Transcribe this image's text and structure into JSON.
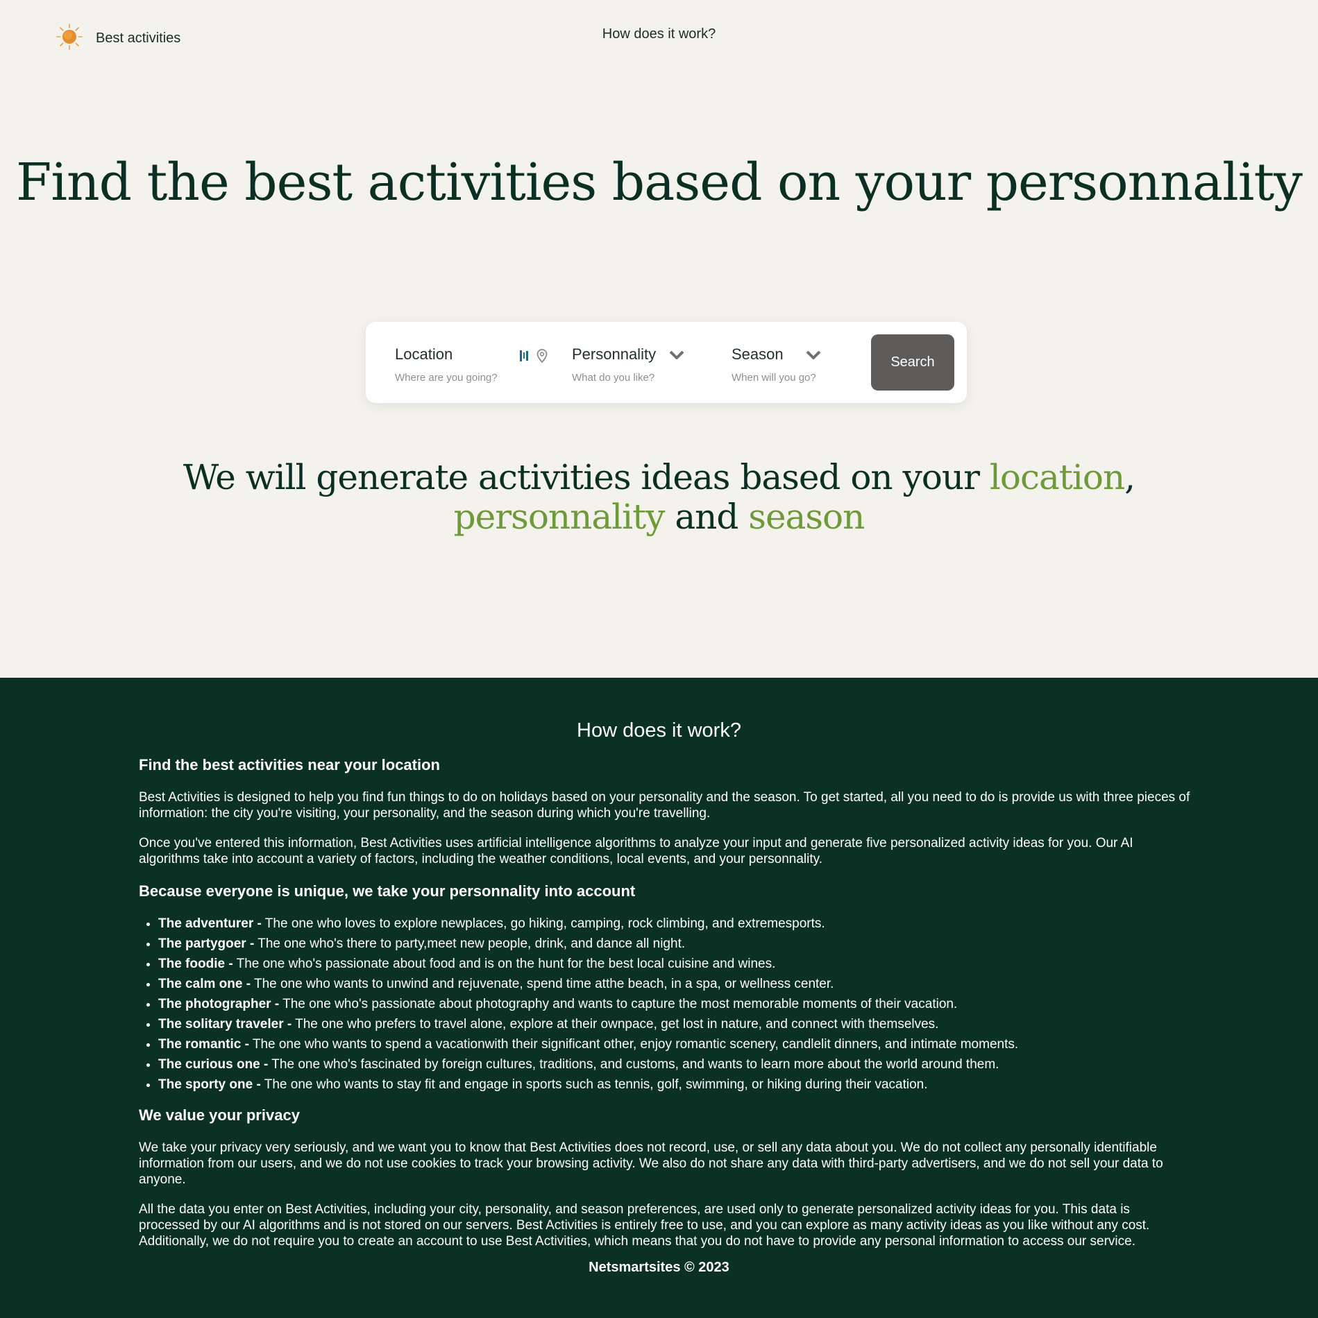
{
  "header": {
    "brand": "Best activities",
    "nav_link": "How does it work?"
  },
  "hero": {
    "title": "Find the best activities based on your personnality"
  },
  "search": {
    "location_label": "Location",
    "location_hint": "Where are you going?",
    "personality_label": "Personnality",
    "personality_hint": "What do you like?",
    "season_label": "Season",
    "season_hint": "When will you go?",
    "button_label": "Search"
  },
  "subtitle": {
    "part1": "We will generate activities ideas based on your ",
    "location": "location",
    "comma": ",",
    "personality": "personnality",
    "and": " and ",
    "season": "season"
  },
  "how": {
    "title": "How does it work?",
    "section1_heading": "Find the best activities near your location",
    "p1": "Best Activities is designed to help you find fun things to do on holidays based on your personality and the season. To get started, all you need to do is provide us with three pieces of information: the city you're visiting, your personality, and the season during which you're travelling.",
    "p2": "Once you've entered this information, Best Activities uses artificial intelligence algorithms to analyze your input and generate five personalized activity ideas for you. Our AI algorithms take into account a variety of factors, including the weather conditions, local events, and your personnality.",
    "section2_heading": "Because everyone is unique, we take your personnality into account",
    "personalities": [
      {
        "name": "The adventurer -",
        "desc": " The one who loves to explore newplaces, go hiking, camping, rock climbing, and extremesports."
      },
      {
        "name": "The partygoer -",
        "desc": " The one who's there to party,meet new people, drink, and dance all night."
      },
      {
        "name": "The foodie -",
        "desc": " The one who's passionate about food and is on the hunt for the best local cuisine and wines."
      },
      {
        "name": "The calm one -",
        "desc": " The one who wants to unwind and rejuvenate, spend time atthe beach, in a spa, or wellness center."
      },
      {
        "name": "The photographer -",
        "desc": " The one who's passionate about photography and wants to capture the most memorable moments of their vacation."
      },
      {
        "name": "The solitary traveler -",
        "desc": " The one who prefers to travel alone, explore at their ownpace, get lost in nature, and connect with themselves."
      },
      {
        "name": "The romantic -",
        "desc": " The one who wants to spend a vacationwith their significant other, enjoy romantic scenery, candlelit dinners, and intimate moments."
      },
      {
        "name": "The curious one -",
        "desc": " The one who's fascinated by foreign cultures, traditions, and customs, and wants to learn more about the world around them."
      },
      {
        "name": "The sporty one -",
        "desc": " The one who wants to stay fit and engage in sports such as tennis, golf, swimming, or hiking during their vacation."
      }
    ],
    "section3_heading": "We value your privacy",
    "p3": "We take your privacy very seriously, and we want you to know that Best Activities does not record, use, or sell any data about you. We do not collect any personally identifiable information from our users, and we do not use cookies to track your browsing activity. We also do not share any data with third-party advertisers, and we do not sell your data to anyone.",
    "p4": "All the data you enter on Best Activities, including your city, personality, and season preferences, are used only to generate personalized activity ideas for you. This data is processed by our AI algorithms and is not stored on our servers. Best Activities is entirely free to use, and you can explore as many activity ideas as you like without any cost. Additionally, we do not require you to create an account to use Best Activities, which means that you do not have to provide any personal information to access our service."
  },
  "footer": {
    "text": "Netsmartsites © 2023"
  },
  "colors": {
    "background": "#f4f2ec",
    "dark_green": "#0b3124",
    "accent_green": "#6e9a3a",
    "button": "#5e5b5b"
  },
  "icons": [
    "sun-icon",
    "barcode-icon",
    "map-pin-icon",
    "chevron-down-icon"
  ]
}
